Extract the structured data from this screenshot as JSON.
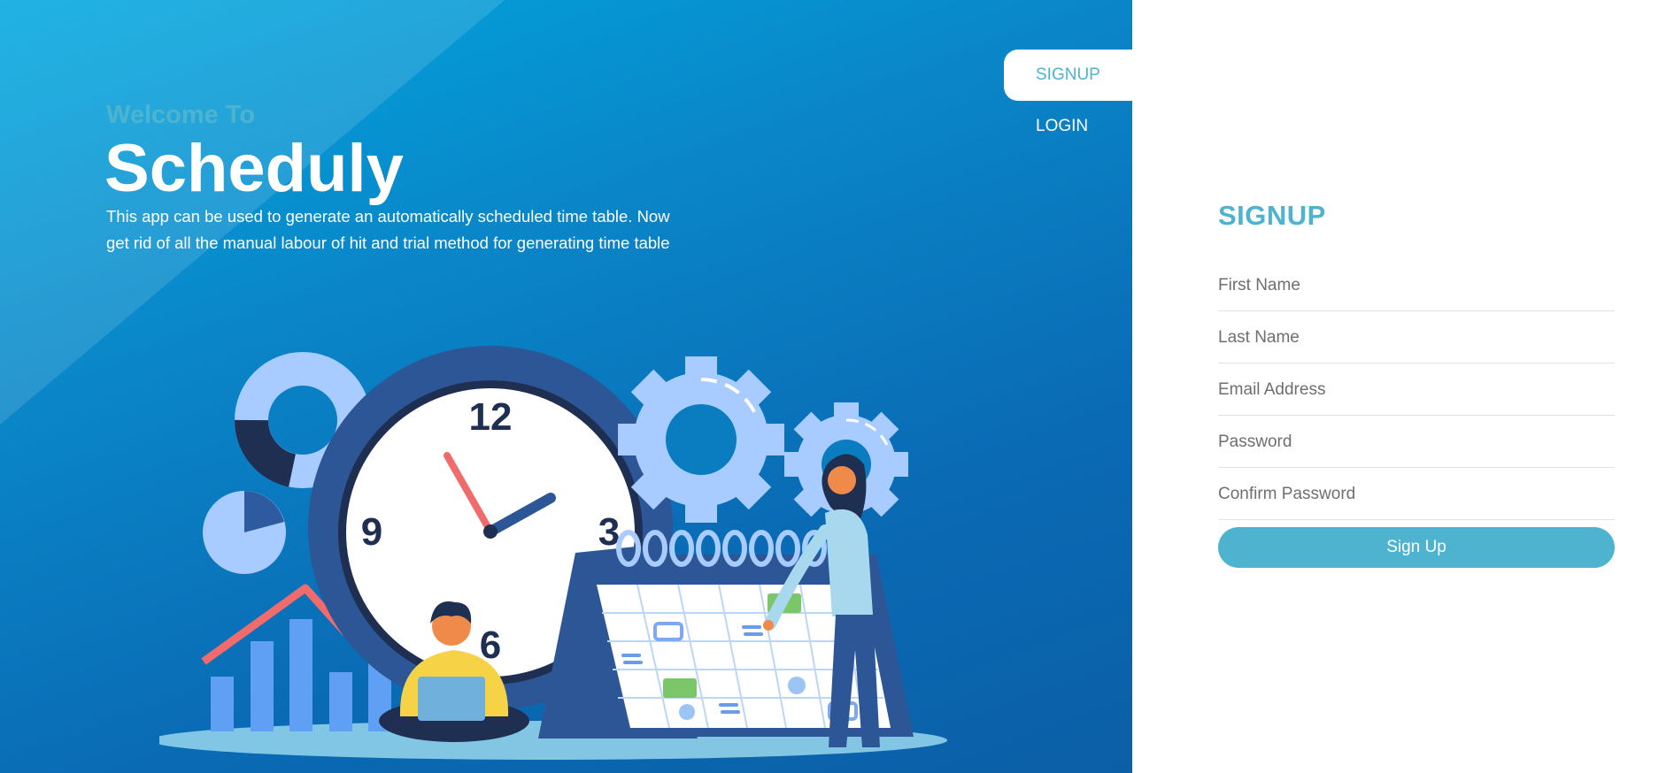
{
  "colors": {
    "accent": "#4eb3cf",
    "panel_bg": "#0a7fc2",
    "white": "#ffffff"
  },
  "hero": {
    "welcome": "Welcome To",
    "app_name": "Scheduly",
    "description": "This app can be used to generate an automatically scheduled time table. Now get rid of all the manual labour of hit and trial method for generating time table"
  },
  "illustration": {
    "clock_numbers": [
      "12",
      "3",
      "6",
      "9"
    ],
    "icons": [
      "clock-icon",
      "gear-icon",
      "calendar-icon",
      "bar-chart-icon",
      "pie-chart-icon",
      "donut-chart-icon"
    ]
  },
  "tabs": [
    {
      "label": "SIGNUP",
      "active": true
    },
    {
      "label": "LOGIN",
      "active": false
    }
  ],
  "form": {
    "title": "SIGNUP",
    "first_name": {
      "placeholder": "First Name",
      "value": ""
    },
    "last_name": {
      "placeholder": "Last Name",
      "value": ""
    },
    "email": {
      "placeholder": "Email Address",
      "value": ""
    },
    "password": {
      "placeholder": "Password",
      "value": ""
    },
    "confirm_password": {
      "placeholder": "Confirm Password",
      "value": ""
    },
    "submit_label": "Sign Up"
  }
}
